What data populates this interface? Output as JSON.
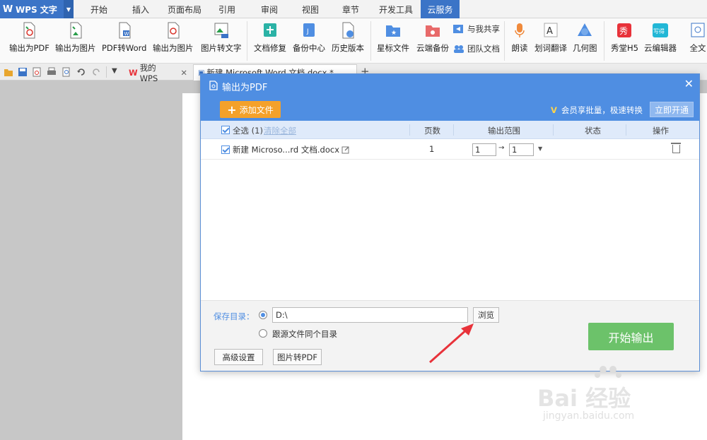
{
  "app": {
    "name": "WPS 文字"
  },
  "menu_tabs": [
    "开始",
    "插入",
    "页面布局",
    "引用",
    "审阅",
    "视图",
    "章节",
    "开发工具",
    "云服务"
  ],
  "ribbon": {
    "items": [
      "输出为PDF",
      "输出为图片",
      "PDF转Word",
      "输出为图片",
      "图片转文字",
      "文档修复",
      "备份中心",
      "历史版本",
      "星标文件",
      "云端备份",
      "朗读",
      "划词翻译",
      "几何图",
      "秀堂H5",
      "云编辑器",
      "全文"
    ],
    "small_items": [
      "与我共享",
      "团队文档"
    ]
  },
  "doc_tabs": {
    "home": "我的WPS",
    "doc": "新建 Microsoft Word 文档.docx *"
  },
  "dialog": {
    "title": "输出为PDF",
    "add_file": "添加文件",
    "vip_text": "会员享批量，极速转换",
    "open_now": "立即开通",
    "columns": {
      "select_all": "全选 (1)",
      "clear_all": "清除全部",
      "pages": "页数",
      "range": "输出范围",
      "status": "状态",
      "action": "操作"
    },
    "rows": [
      {
        "name": "新建 Microso...rd 文档.docx",
        "pages": "1",
        "from": "1",
        "to": "1"
      }
    ],
    "save_dir_label": "保存目录：",
    "save_path": "D:\\",
    "browse": "浏览",
    "same_dir": "跟源文件同个目录",
    "advanced": "高级设置",
    "img_to_pdf": "图片转PDF",
    "start": "开始输出"
  },
  "watermark": {
    "brand": "Bai 经验",
    "url": "jingyan.baidu.com"
  },
  "colors": {
    "accent": "#4f8ee2",
    "orange": "#f4a12a",
    "green": "#6cc26a",
    "annotation": "#e8323a"
  }
}
